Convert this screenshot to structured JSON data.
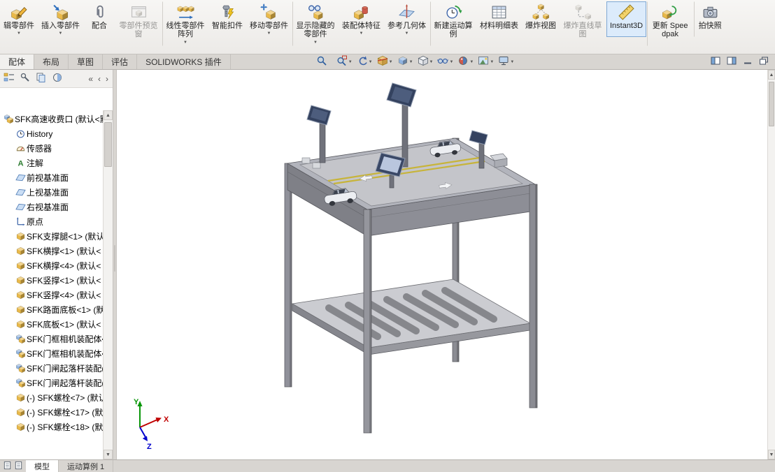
{
  "ribbon": {
    "buttons": [
      {
        "label": "辑零部件",
        "icon": "edit-component",
        "dropdown": true
      },
      {
        "label": "插入零部件",
        "icon": "insert-component",
        "dropdown": true
      },
      {
        "label": "配合",
        "icon": "mate"
      },
      {
        "label": "零部件预览窗",
        "icon": "preview-window",
        "disabled": true
      },
      {
        "label": "线性零部件阵列",
        "icon": "linear-pattern",
        "dropdown": true,
        "sep": true
      },
      {
        "label": "智能扣件",
        "icon": "smart-fasteners"
      },
      {
        "label": "移动零部件",
        "icon": "move-component",
        "dropdown": true
      },
      {
        "label": "显示隐藏的零部件",
        "icon": "show-hidden",
        "dropdown": true,
        "sep": true
      },
      {
        "label": "装配体特征",
        "icon": "assembly-features",
        "dropdown": true
      },
      {
        "label": "参考几何体",
        "icon": "reference-geometry",
        "dropdown": true
      },
      {
        "label": "新建运动算例",
        "icon": "motion-study",
        "sep": true
      },
      {
        "label": "材料明细表",
        "icon": "bom"
      },
      {
        "label": "爆炸视图",
        "icon": "exploded-view"
      },
      {
        "label": "爆炸直线草图",
        "icon": "explode-line-sketch",
        "disabled": true
      },
      {
        "label": "Instant3D",
        "icon": "instant3d",
        "active": true,
        "sep": true
      },
      {
        "label": "更新 Speedpak",
        "icon": "update-speedpak",
        "sep": true
      },
      {
        "label": "拍快照",
        "icon": "snapshot",
        "sep": true
      }
    ]
  },
  "command_tabs": {
    "tabs": [
      {
        "label": "配体",
        "active": true,
        "name": "assembly"
      },
      {
        "label": "布局",
        "name": "layout"
      },
      {
        "label": "草图",
        "name": "sketch"
      },
      {
        "label": "评估",
        "name": "evaluate"
      },
      {
        "label": "SOLIDWORKS 插件",
        "name": "solidworks-addins"
      }
    ]
  },
  "view_toolbar": {
    "buttons": [
      {
        "icon": "zoom-fit",
        "name": "zoom-to-fit"
      },
      {
        "icon": "zoom-area",
        "name": "zoom-to-area",
        "dropdown": true
      },
      {
        "icon": "prev-view",
        "name": "previous-view",
        "dropdown": true
      },
      {
        "icon": "section-view",
        "name": "section-view",
        "dropdown": true
      },
      {
        "icon": "view-orientation",
        "name": "view-orientation",
        "dropdown": true
      },
      {
        "icon": "display-style",
        "name": "display-style",
        "dropdown": true
      },
      {
        "icon": "hide-show",
        "name": "hide-show-items",
        "dropdown": true
      },
      {
        "icon": "edit-appearance",
        "name": "edit-appearance",
        "dropdown": true
      },
      {
        "icon": "apply-scene",
        "name": "apply-scene",
        "dropdown": true
      },
      {
        "icon": "view-settings",
        "name": "view-settings",
        "dropdown": true
      }
    ]
  },
  "window_controls": {
    "buttons": [
      {
        "icon": "pane-left",
        "name": "toggle-left-pane"
      },
      {
        "icon": "pane-right",
        "name": "toggle-right-pane"
      },
      {
        "icon": "win-minimize",
        "name": "minimize-window"
      },
      {
        "icon": "win-restore",
        "name": "restore-window"
      }
    ]
  },
  "panel": {
    "tabs": [
      {
        "icon": "mgr-feature",
        "name": "featuremanager"
      },
      {
        "icon": "mgr-property",
        "name": "propertymanager"
      },
      {
        "icon": "mgr-config",
        "name": "configurationmanager"
      },
      {
        "icon": "mgr-display",
        "name": "displaymanager"
      }
    ],
    "nav": [
      {
        "glyph": "«",
        "name": "nav-collapse"
      },
      {
        "glyph": "‹",
        "name": "nav-prev"
      },
      {
        "glyph": "›",
        "name": "nav-next"
      }
    ]
  },
  "feature_tree": {
    "items": [
      {
        "label": "SFK高速收费口 (默认<默",
        "icon": "assembly-top",
        "level": 0,
        "name": "assembly-root"
      },
      {
        "label": "History",
        "icon": "history",
        "level": 1,
        "name": "history"
      },
      {
        "label": "传感器",
        "icon": "sensors",
        "level": 1,
        "name": "sensors"
      },
      {
        "label": "注解",
        "icon": "annotations",
        "level": 1,
        "name": "annotations"
      },
      {
        "label": "前视基准面",
        "icon": "plane",
        "level": 1,
        "name": "front-plane"
      },
      {
        "label": "上视基准面",
        "icon": "plane",
        "level": 1,
        "name": "top-plane"
      },
      {
        "label": "右视基准面",
        "icon": "plane",
        "level": 1,
        "name": "right-plane"
      },
      {
        "label": "原点",
        "icon": "origin",
        "level": 1,
        "name": "origin"
      },
      {
        "label": "SFK支撑腿<1> (默认",
        "icon": "part",
        "level": 1,
        "name": "support-leg-1"
      },
      {
        "label": "SFK横撑<1> (默认<",
        "icon": "part",
        "level": 1,
        "name": "cross-brace-1"
      },
      {
        "label": "SFK横撑<4> (默认<",
        "icon": "part",
        "level": 1,
        "name": "cross-brace-4"
      },
      {
        "label": "SFK竖撑<1> (默认<",
        "icon": "part",
        "level": 1,
        "name": "vertical-brace-1"
      },
      {
        "label": "SFK竖撑<4> (默认<",
        "icon": "part",
        "level": 1,
        "name": "vertical-brace-4"
      },
      {
        "label": "SFK路面底板<1> (默",
        "icon": "part",
        "level": 1,
        "name": "road-plate-1"
      },
      {
        "label": "SFK底板<1> (默认<",
        "icon": "part",
        "level": 1,
        "name": "base-plate-1"
      },
      {
        "label": "SFK门框相机装配体<",
        "icon": "subassembly",
        "level": 1,
        "name": "camera-frame-asm-1"
      },
      {
        "label": "SFK门框相机装配体<",
        "icon": "subassembly",
        "level": 1,
        "name": "camera-frame-asm-2"
      },
      {
        "label": "SFK门闸起落杆装配(",
        "icon": "subassembly",
        "level": 1,
        "name": "gate-arm-asm-1"
      },
      {
        "label": "SFK门闸起落杆装配(",
        "icon": "subassembly",
        "level": 1,
        "name": "gate-arm-asm-2"
      },
      {
        "label": "(-) SFK螺栓<7> (默认",
        "icon": "part",
        "level": 1,
        "name": "bolt-7"
      },
      {
        "label": "(-) SFK螺栓<17> (默",
        "icon": "part",
        "level": 1,
        "name": "bolt-17"
      },
      {
        "label": "(-) SFK螺栓<18> (默",
        "icon": "part",
        "level": 1,
        "name": "bolt-18"
      }
    ]
  },
  "bottom_bar": {
    "controls": [
      {
        "icon": "sheet",
        "name": "tab-control-1"
      },
      {
        "icon": "sheet",
        "name": "tab-control-2"
      }
    ]
  },
  "bottom_tabs": {
    "tabs": [
      {
        "label": "模型",
        "active": true,
        "name": "model"
      },
      {
        "label": "运动算例 1",
        "name": "motion-study-1"
      }
    ]
  },
  "triad": {
    "x_label": "X",
    "y_label": "Y",
    "z_label": "Z"
  },
  "colors": {
    "accent_blue": "#2e6fbd",
    "part_yellow": "#e9b949",
    "selection_bg": "#dcebfb",
    "triad_x": "#c00000",
    "triad_y": "#089608",
    "triad_z": "#0000cd"
  }
}
